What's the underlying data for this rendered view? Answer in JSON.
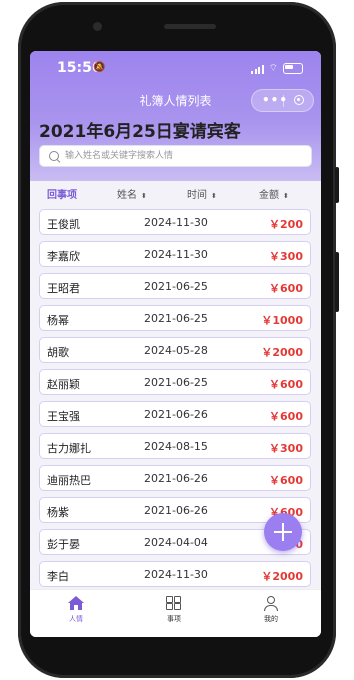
{
  "status_bar": {
    "time": "15:56"
  },
  "nav": {
    "title": "礼簿人情列表",
    "more_label": "•••"
  },
  "page": {
    "heading": "2021年6月25日宴请宾客"
  },
  "search": {
    "placeholder": "输入姓名或关键字搜索人情",
    "value": ""
  },
  "columns": {
    "tab": "回事项",
    "name": "姓名",
    "time": "时间",
    "amount": "金额",
    "sort_glyph": "⬍"
  },
  "records": [
    {
      "name": "王俊凯",
      "date": "2024-11-30",
      "amount": "￥200"
    },
    {
      "name": "李嘉欣",
      "date": "2024-11-30",
      "amount": "￥300"
    },
    {
      "name": "王昭君",
      "date": "2021-06-25",
      "amount": "￥600"
    },
    {
      "name": "杨幂",
      "date": "2021-06-25",
      "amount": "￥1000"
    },
    {
      "name": "胡歌",
      "date": "2024-05-28",
      "amount": "￥2000"
    },
    {
      "name": "赵丽颖",
      "date": "2021-06-25",
      "amount": "￥600"
    },
    {
      "name": "王宝强",
      "date": "2021-06-26",
      "amount": "￥600"
    },
    {
      "name": "古力娜扎",
      "date": "2024-08-15",
      "amount": "￥300"
    },
    {
      "name": "迪丽热巴",
      "date": "2021-06-26",
      "amount": "￥600"
    },
    {
      "name": "杨紫",
      "date": "2021-06-26",
      "amount": "￥600"
    },
    {
      "name": "彭于晏",
      "date": "2024-04-04",
      "amount": "￥600"
    },
    {
      "name": "李白",
      "date": "2024-11-30",
      "amount": "￥2000"
    }
  ],
  "tabbar": {
    "home": "人情",
    "items": "事项",
    "mine": "我的"
  },
  "colors": {
    "accent": "#9d84ee",
    "amount": "#e53935"
  }
}
